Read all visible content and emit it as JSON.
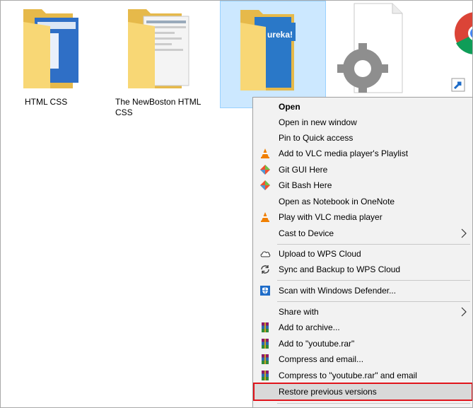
{
  "files": [
    {
      "label": "HTML CSS",
      "icon": "folder-icon"
    },
    {
      "label": "The NewBoston HTML\nCSS",
      "icon": "folder-icon"
    },
    {
      "label": "",
      "icon": "folder-icon",
      "selected": true,
      "badge_text": "ureka!"
    },
    {
      "label": "",
      "icon": "settings-file-icon"
    },
    {
      "label": "",
      "icon": "chrome-shortcut-icon"
    }
  ],
  "menu": {
    "open": "Open",
    "open_new_window": "Open in new window",
    "pin_quick_access": "Pin to Quick access",
    "vlc_playlist": "Add to VLC media player's Playlist",
    "git_gui": "Git GUI Here",
    "git_bash": "Git Bash Here",
    "onenote": "Open as Notebook in OneNote",
    "vlc_play": "Play with VLC media player",
    "cast": "Cast to Device",
    "wps_upload": "Upload to WPS Cloud",
    "wps_sync": "Sync and Backup to WPS Cloud",
    "defender": "Scan with Windows Defender...",
    "share": "Share with",
    "add_archive": "Add to archive...",
    "add_rar": "Add to \"youtube.rar\"",
    "compress_email": "Compress and email...",
    "compress_rar_email": "Compress to \"youtube.rar\" and email",
    "restore": "Restore previous versions"
  },
  "colors": {
    "selection_bg": "#cce8ff",
    "menu_bg": "#f2f2f2",
    "highlight_bg": "#d9d9d9",
    "emphasis_box": "#e0141b",
    "folder_yellow": "#f8d775"
  }
}
